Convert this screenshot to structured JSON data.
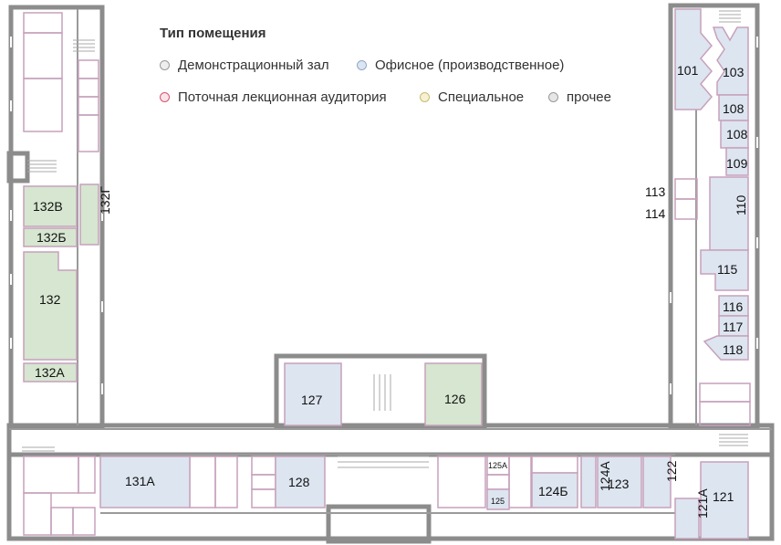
{
  "legend": {
    "title": "Тип помещения",
    "items": [
      {
        "label": "Демонстрационный зал",
        "fill": "#eeeeee",
        "stroke": "#999999"
      },
      {
        "label": "Офисное (производственное)",
        "fill": "#dde5f0",
        "stroke": "#8fa8cc"
      },
      {
        "label": "Поточная лекционная аудитория",
        "fill": "#fbe3ea",
        "stroke": "#d4566f"
      },
      {
        "label": "Специальное",
        "fill": "#f6f1d2",
        "stroke": "#c8bb72"
      },
      {
        "label": "прочее",
        "fill": "#e6e6e6",
        "stroke": "#999999"
      }
    ]
  },
  "colors": {
    "wall": "#8c8c8c",
    "room_outline": "#c6a1bb",
    "office_fill": "#dde5f0",
    "special_fill": "#d6e6d0",
    "background": "#ffffff"
  },
  "rooms": {
    "r101": "101",
    "r103": "103",
    "r108a": "108",
    "r108b": "108",
    "r109": "109",
    "r113": "113",
    "r114": "114",
    "r110": "110",
    "r115": "115",
    "r116": "116",
    "r117": "117",
    "r118": "118",
    "r121": "121",
    "r121A": "121А",
    "r122": "122",
    "r123": "123",
    "r124A": "124А",
    "r124B": "124Б",
    "r125": "125",
    "r125A": "125А",
    "r126": "126",
    "r127": "127",
    "r128": "128",
    "r131A": "131А",
    "r132": "132",
    "r132A": "132А",
    "r132B": "132Б",
    "r132V": "132В",
    "r132G": "132Г"
  }
}
